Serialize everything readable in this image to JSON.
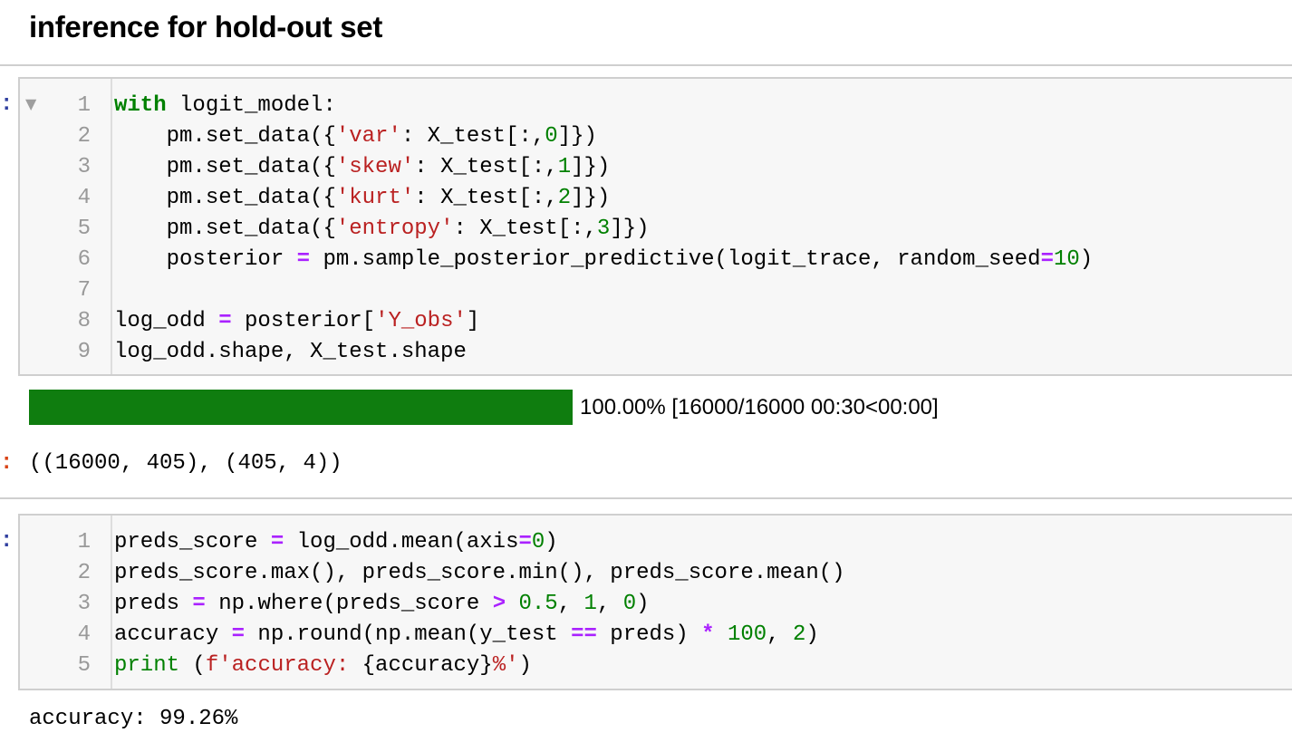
{
  "heading": "inference for hold-out set",
  "cells": [
    {
      "prompt": ":",
      "line_numbers": [
        "1",
        "2",
        "3",
        "4",
        "5",
        "6",
        "7",
        "8",
        "9"
      ],
      "code_lines": [
        [
          {
            "t": "with",
            "c": "kw"
          },
          {
            "t": " logit_model:",
            "c": ""
          }
        ],
        [
          {
            "t": "    pm.set_data({",
            "c": ""
          },
          {
            "t": "'var'",
            "c": "str"
          },
          {
            "t": ": X_test[:,",
            "c": ""
          },
          {
            "t": "0",
            "c": "num"
          },
          {
            "t": "]})",
            "c": ""
          }
        ],
        [
          {
            "t": "    pm.set_data({",
            "c": ""
          },
          {
            "t": "'skew'",
            "c": "str"
          },
          {
            "t": ": X_test[:,",
            "c": ""
          },
          {
            "t": "1",
            "c": "num"
          },
          {
            "t": "]})",
            "c": ""
          }
        ],
        [
          {
            "t": "    pm.set_data({",
            "c": ""
          },
          {
            "t": "'kurt'",
            "c": "str"
          },
          {
            "t": ": X_test[:,",
            "c": ""
          },
          {
            "t": "2",
            "c": "num"
          },
          {
            "t": "]})",
            "c": ""
          }
        ],
        [
          {
            "t": "    pm.set_data({",
            "c": ""
          },
          {
            "t": "'entropy'",
            "c": "str"
          },
          {
            "t": ": X_test[:,",
            "c": ""
          },
          {
            "t": "3",
            "c": "num"
          },
          {
            "t": "]})",
            "c": ""
          }
        ],
        [
          {
            "t": "    posterior ",
            "c": ""
          },
          {
            "t": "=",
            "c": "op"
          },
          {
            "t": " pm.sample_posterior_predictive(logit_trace, random_seed",
            "c": ""
          },
          {
            "t": "=",
            "c": "op"
          },
          {
            "t": "10",
            "c": "num"
          },
          {
            "t": ")",
            "c": ""
          }
        ],
        [
          {
            "t": "",
            "c": ""
          }
        ],
        [
          {
            "t": "log_odd ",
            "c": ""
          },
          {
            "t": "=",
            "c": "op"
          },
          {
            "t": " posterior[",
            "c": ""
          },
          {
            "t": "'Y_obs'",
            "c": "str"
          },
          {
            "t": "]",
            "c": ""
          }
        ],
        [
          {
            "t": "log_odd.shape, X_test.shape",
            "c": ""
          }
        ]
      ],
      "progress": {
        "fraction": 1.0,
        "status_text": "100.00% [16000/16000 00:30<00:00]"
      },
      "output_prompt": ":",
      "output_text": "((16000, 405), (405, 4))"
    },
    {
      "prompt": ":",
      "line_numbers": [
        "1",
        "2",
        "3",
        "4",
        "5"
      ],
      "code_lines": [
        [
          {
            "t": "preds_score ",
            "c": ""
          },
          {
            "t": "=",
            "c": "op"
          },
          {
            "t": " log_odd.mean(axis",
            "c": ""
          },
          {
            "t": "=",
            "c": "op"
          },
          {
            "t": "0",
            "c": "num"
          },
          {
            "t": ")",
            "c": ""
          }
        ],
        [
          {
            "t": "preds_score.max(), preds_score.min(), preds_score.mean()",
            "c": ""
          }
        ],
        [
          {
            "t": "preds ",
            "c": ""
          },
          {
            "t": "=",
            "c": "op"
          },
          {
            "t": " np.where(preds_score ",
            "c": ""
          },
          {
            "t": ">",
            "c": "op"
          },
          {
            "t": " ",
            "c": ""
          },
          {
            "t": "0.5",
            "c": "num"
          },
          {
            "t": ", ",
            "c": ""
          },
          {
            "t": "1",
            "c": "num"
          },
          {
            "t": ", ",
            "c": ""
          },
          {
            "t": "0",
            "c": "num"
          },
          {
            "t": ")",
            "c": ""
          }
        ],
        [
          {
            "t": "accuracy ",
            "c": ""
          },
          {
            "t": "=",
            "c": "op"
          },
          {
            "t": " np.round(np.mean(y_test ",
            "c": ""
          },
          {
            "t": "==",
            "c": "op"
          },
          {
            "t": " preds) ",
            "c": ""
          },
          {
            "t": "*",
            "c": "op"
          },
          {
            "t": " ",
            "c": ""
          },
          {
            "t": "100",
            "c": "num"
          },
          {
            "t": ", ",
            "c": ""
          },
          {
            "t": "2",
            "c": "num"
          },
          {
            "t": ")",
            "c": ""
          }
        ],
        [
          {
            "t": "print",
            "c": "bi"
          },
          {
            "t": " (",
            "c": ""
          },
          {
            "t": "f'accuracy: ",
            "c": "str"
          },
          {
            "t": "{accuracy}",
            "c": ""
          },
          {
            "t": "%'",
            "c": "str"
          },
          {
            "t": ")",
            "c": ""
          }
        ]
      ],
      "output_text": "accuracy: 99.26%"
    }
  ]
}
